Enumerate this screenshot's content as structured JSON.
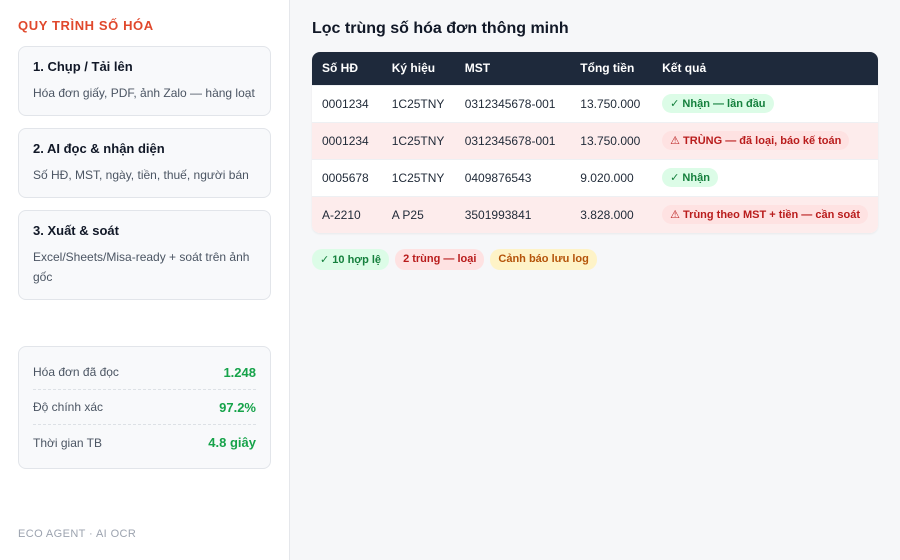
{
  "sidebar": {
    "title": "QUY TRÌNH SỐ HÓA",
    "steps": [
      {
        "title": "1. Chụp / Tải lên",
        "desc": "Hóa đơn giấy, PDF, ảnh Zalo — hàng loạt"
      },
      {
        "title": "2. AI đọc & nhận diện",
        "desc": "Số HĐ, MST, ngày, tiền, thuế, người bán"
      },
      {
        "title": "3. Xuất & soát",
        "desc": "Excel/Sheets/Misa-ready + soát trên ảnh gốc"
      }
    ],
    "stats": [
      {
        "label": "Hóa đơn đã đọc",
        "value": "1.248"
      },
      {
        "label": "Độ chính xác",
        "value": "97.2%"
      },
      {
        "label": "Thời gian TB",
        "value": "4.8 giây"
      }
    ],
    "footer": "ECO AGENT · AI OCR"
  },
  "main": {
    "title": "Lọc trùng số hóa đơn thông minh",
    "columns": [
      "Số HĐ",
      "Ký hiệu",
      "MST",
      "Tổng tiền",
      "Kết quả"
    ],
    "rows": [
      {
        "so_hd": "0001234",
        "ky_hieu": "1C25TNY",
        "mst": "0312345678-001",
        "tong_tien": "13.750.000",
        "ket_qua": "✓ Nhận — lần đầu",
        "status": "ok"
      },
      {
        "so_hd": "0001234",
        "ky_hieu": "1C25TNY",
        "mst": "0312345678-001",
        "tong_tien": "13.750.000",
        "ket_qua": "⚠ TRÙNG — đã loại, báo kế toán",
        "status": "dup"
      },
      {
        "so_hd": "0005678",
        "ky_hieu": "1C25TNY",
        "mst": "0409876543",
        "tong_tien": "9.020.000",
        "ket_qua": "✓ Nhận",
        "status": "ok"
      },
      {
        "so_hd": "A-2210",
        "ky_hieu": "A P25",
        "mst": "3501993841",
        "tong_tien": "3.828.000",
        "ket_qua": "⚠ Trùng theo MST + tiền — cần soát",
        "status": "dup"
      }
    ],
    "summary": {
      "valid": "✓ 10 hợp lệ",
      "duplicates": "2 trùng — loại",
      "warning": "Cảnh báo lưu log"
    }
  },
  "colors": {
    "accent": "#e0482c",
    "header_bg": "#1e293b",
    "ok": "#15803d",
    "dup": "#b91c1c",
    "warn": "#b45309"
  }
}
